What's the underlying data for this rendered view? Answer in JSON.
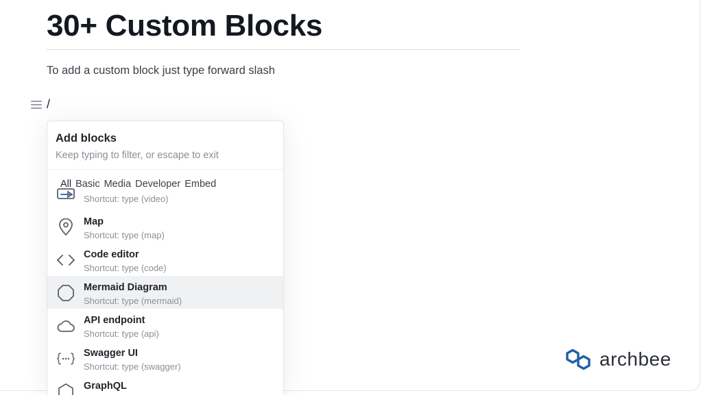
{
  "page": {
    "title": "30+ Custom Blocks",
    "intro": "To add a custom block just type forward slash",
    "slash_text": "/"
  },
  "menu": {
    "title": "Add blocks",
    "subtitle": "Keep typing to filter, or escape to exit",
    "tabs": [
      {
        "label": "All",
        "active": true
      },
      {
        "label": "Basic"
      },
      {
        "label": "Media"
      },
      {
        "label": "Developer"
      },
      {
        "label": "Embed"
      }
    ],
    "items": [
      {
        "name": "",
        "shortcut": "Shortcut: type (video)",
        "icon": "video-icon"
      },
      {
        "name": "Map",
        "shortcut": "Shortcut: type (map)",
        "icon": "map-pin-icon"
      },
      {
        "name": "Code editor",
        "shortcut": "Shortcut: type (code)",
        "icon": "code-icon"
      },
      {
        "name": "Mermaid Diagram",
        "shortcut": "Shortcut: type (mermaid)",
        "icon": "octagon-icon",
        "highlighted": true
      },
      {
        "name": "API endpoint",
        "shortcut": "Shortcut: type (api)",
        "icon": "cloud-icon"
      },
      {
        "name": "Swagger UI",
        "shortcut": "Shortcut: type (swagger)",
        "icon": "curly-braces-icon"
      },
      {
        "name": "GraphQL",
        "shortcut": "",
        "icon": "graphql-icon"
      }
    ]
  },
  "brand": {
    "name": "archbee",
    "color": "#1f5fa8"
  }
}
